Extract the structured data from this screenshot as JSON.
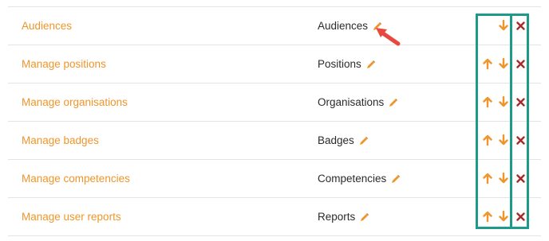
{
  "rows": [
    {
      "link": "Audiences",
      "name": "Audiences",
      "has_up": false,
      "has_down": true
    },
    {
      "link": "Manage positions",
      "name": "Positions",
      "has_up": true,
      "has_down": true
    },
    {
      "link": "Manage organisations",
      "name": "Organisations",
      "has_up": true,
      "has_down": true
    },
    {
      "link": "Manage badges",
      "name": "Badges",
      "has_up": true,
      "has_down": true
    },
    {
      "link": "Manage competencies",
      "name": "Competencies",
      "has_up": true,
      "has_down": true
    },
    {
      "link": "Manage user reports",
      "name": "Reports",
      "has_up": true,
      "has_down": true
    }
  ],
  "icons": {
    "edit": "pencil-icon",
    "move_up": "arrow-up-icon",
    "move_down": "arrow-down-icon",
    "delete": "delete-x-icon",
    "annotation": "red-pointer-arrow"
  },
  "colors": {
    "link": "#f0952a",
    "delete": "#a52a2a",
    "highlight_box": "#1e9a8a",
    "pointer": "#e8483e"
  }
}
